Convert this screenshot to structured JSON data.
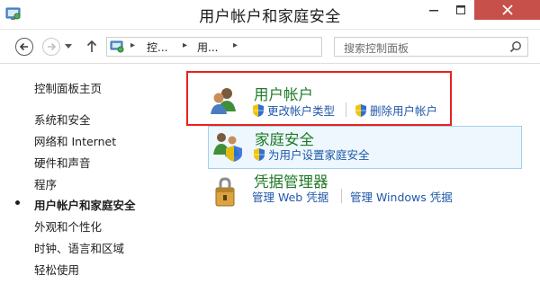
{
  "window": {
    "title": "用户帐户和家庭安全"
  },
  "address": {
    "crumbs": [
      "控...",
      "用..."
    ],
    "search_placeholder": "搜索控制面板"
  },
  "sidebar": {
    "home": "控制面板主页",
    "items": [
      {
        "label": "系统和安全",
        "active": false
      },
      {
        "label": "网络和 Internet",
        "active": false
      },
      {
        "label": "硬件和声音",
        "active": false
      },
      {
        "label": "程序",
        "active": false
      },
      {
        "label": "用户帐户和家庭安全",
        "active": true
      },
      {
        "label": "外观和个性化",
        "active": false
      },
      {
        "label": "时钟、语言和区域",
        "active": false
      },
      {
        "label": "轻松使用",
        "active": false
      }
    ]
  },
  "sections": {
    "accounts": {
      "title": "用户帐户",
      "links": [
        "更改帐户类型",
        "删除用户帐户"
      ]
    },
    "family": {
      "title": "家庭安全",
      "links": [
        "为用户设置家庭安全"
      ]
    },
    "credentials": {
      "title": "凭据管理器",
      "links": [
        "管理 Web 凭据",
        "管理 Windows 凭据"
      ]
    }
  },
  "colors": {
    "section_title": "#1f7a28",
    "link": "#1f58a8",
    "highlight_box": "#e8211e",
    "close_button": "#c7504a"
  }
}
